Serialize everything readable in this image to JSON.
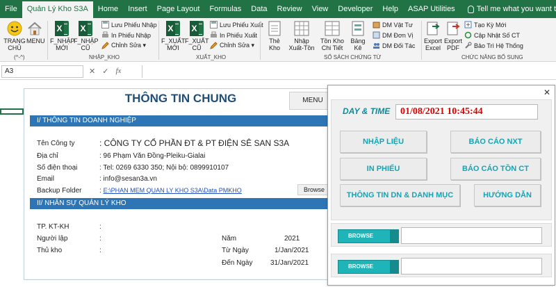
{
  "tabs": [
    "File",
    "Quản Lý Kho S3A",
    "Home",
    "Insert",
    "Page Layout",
    "Formulas",
    "Data",
    "Review",
    "View",
    "Developer",
    "Help",
    "ASAP Utilities"
  ],
  "tell_me": "Tell me what you want to do",
  "ribbon": {
    "trang_chu": "TRANG CHỦ",
    "menu": "MENU",
    "group1_label": "(^-^)",
    "f_nhap_moi": "F_NHẬP MỚI",
    "f_nhap_cu": "F_NHẬP CŨ",
    "luu_phieu_nhap": "Lưu Phiếu Nhập",
    "in_phieu_nhap": "In Phiếu Nhập",
    "chinh_sua_1": "Chỉnh Sửa ▾",
    "nhap_kho": "NHẬP_KHO",
    "f_xuat_moi": "F_XUẤT MỚI",
    "f_xuat_cu": "F_XUẤT CŨ",
    "luu_phieu_xuat": "Lưu Phiếu Xuất",
    "in_phieu_xuat": "In Phiếu Xuất",
    "chinh_sua_2": "Chỉnh Sửa ▾",
    "xuat_kho": "XUẤT_KHO",
    "the_kho": "Thẻ Kho",
    "nhap_xuat_ton": "Nhập Xuất-Tồn",
    "ton_kho_chi_tiet": "Tồn Kho Chi Tiết",
    "bang_ke": "Bảng Kê",
    "dm_vat_tu": "DM Vật Tư",
    "dm_don_vi": "DM Đơn Vị",
    "dm_doi_tac": "DM Đối Tác",
    "so_sach": "SỔ SÁCH CHỨNG TỪ",
    "export_excel": "Export Excel",
    "export_pdf": "Export PDF",
    "tao_ky_moi": "Tạo Kỳ Mới",
    "cap_nhat_so_ct": "Cập Nhật Số CT",
    "bao_tri": "Bảo Trì Hệ Thống",
    "chuc_nang": "CHỨC NĂNG BỔ SUNG"
  },
  "formula_bar": {
    "name_box": "A3",
    "fx": "fx",
    "cancel": "✕",
    "enter": "✓"
  },
  "sheet": {
    "title": "THÔNG TIN CHUNG",
    "menu_button": "MENU",
    "section1": "I/ THÔNG TIN DOANH NGHIỆP",
    "ten_cong_ty_label": "Tên Công ty",
    "ten_cong_ty": ": CÔNG TY CỔ PHẦN ĐT & PT ĐIỆN SÊ SAN S3A",
    "dia_chi_label": "Địa chỉ",
    "dia_chi": ": 96 Phạm Văn Đồng-Pleiku-Gialai",
    "sdt_label": "Số điện thoại",
    "sdt": ": Tel: 0269 6330 350; Nội bộ: 0899910107",
    "email_label": "Email",
    "email": ": info@sesan3a.vn",
    "backup_label": "Backup Folder",
    "backup_colon": ":",
    "backup_path": "E:\\PHAN MEM QUAN LY KHO S3A\\Data PMKHO",
    "browse": "Browse",
    "section2": "II/ NHÂN SỰ QUẢN LÝ KHO",
    "tp_label": "TP. KT-KH",
    "nguoi_lap_label": "Người lập",
    "thu_kho_label": "Thủ kho",
    "colon": ":",
    "nam_label": "Năm",
    "nam": "2021",
    "tu_ngay_label": "Từ Ngày",
    "tu_ngay": "1/Jan/2021",
    "den_ngay_label": "Đến Ngày",
    "den_ngay": "31/Jan/2021"
  },
  "dialog": {
    "close": "✕",
    "day_time_label": "DAY & TIME",
    "clock": "01/08/2021 10:45:44",
    "btn_nhap_lieu": "NHẬP LIỆU",
    "btn_bao_cao_nxt": "BÁO CÁO NXT",
    "btn_in_phieu": "IN PHIẾU",
    "btn_bao_cao_ton_ct": "BÁO CÁO TỒN CT",
    "btn_thong_tin": "THÔNG TIN DN & DANH MỤC",
    "btn_huong_dan": "HƯỚNG DẪN",
    "browse1": "BROWSE",
    "browse2": "BROWSE"
  }
}
